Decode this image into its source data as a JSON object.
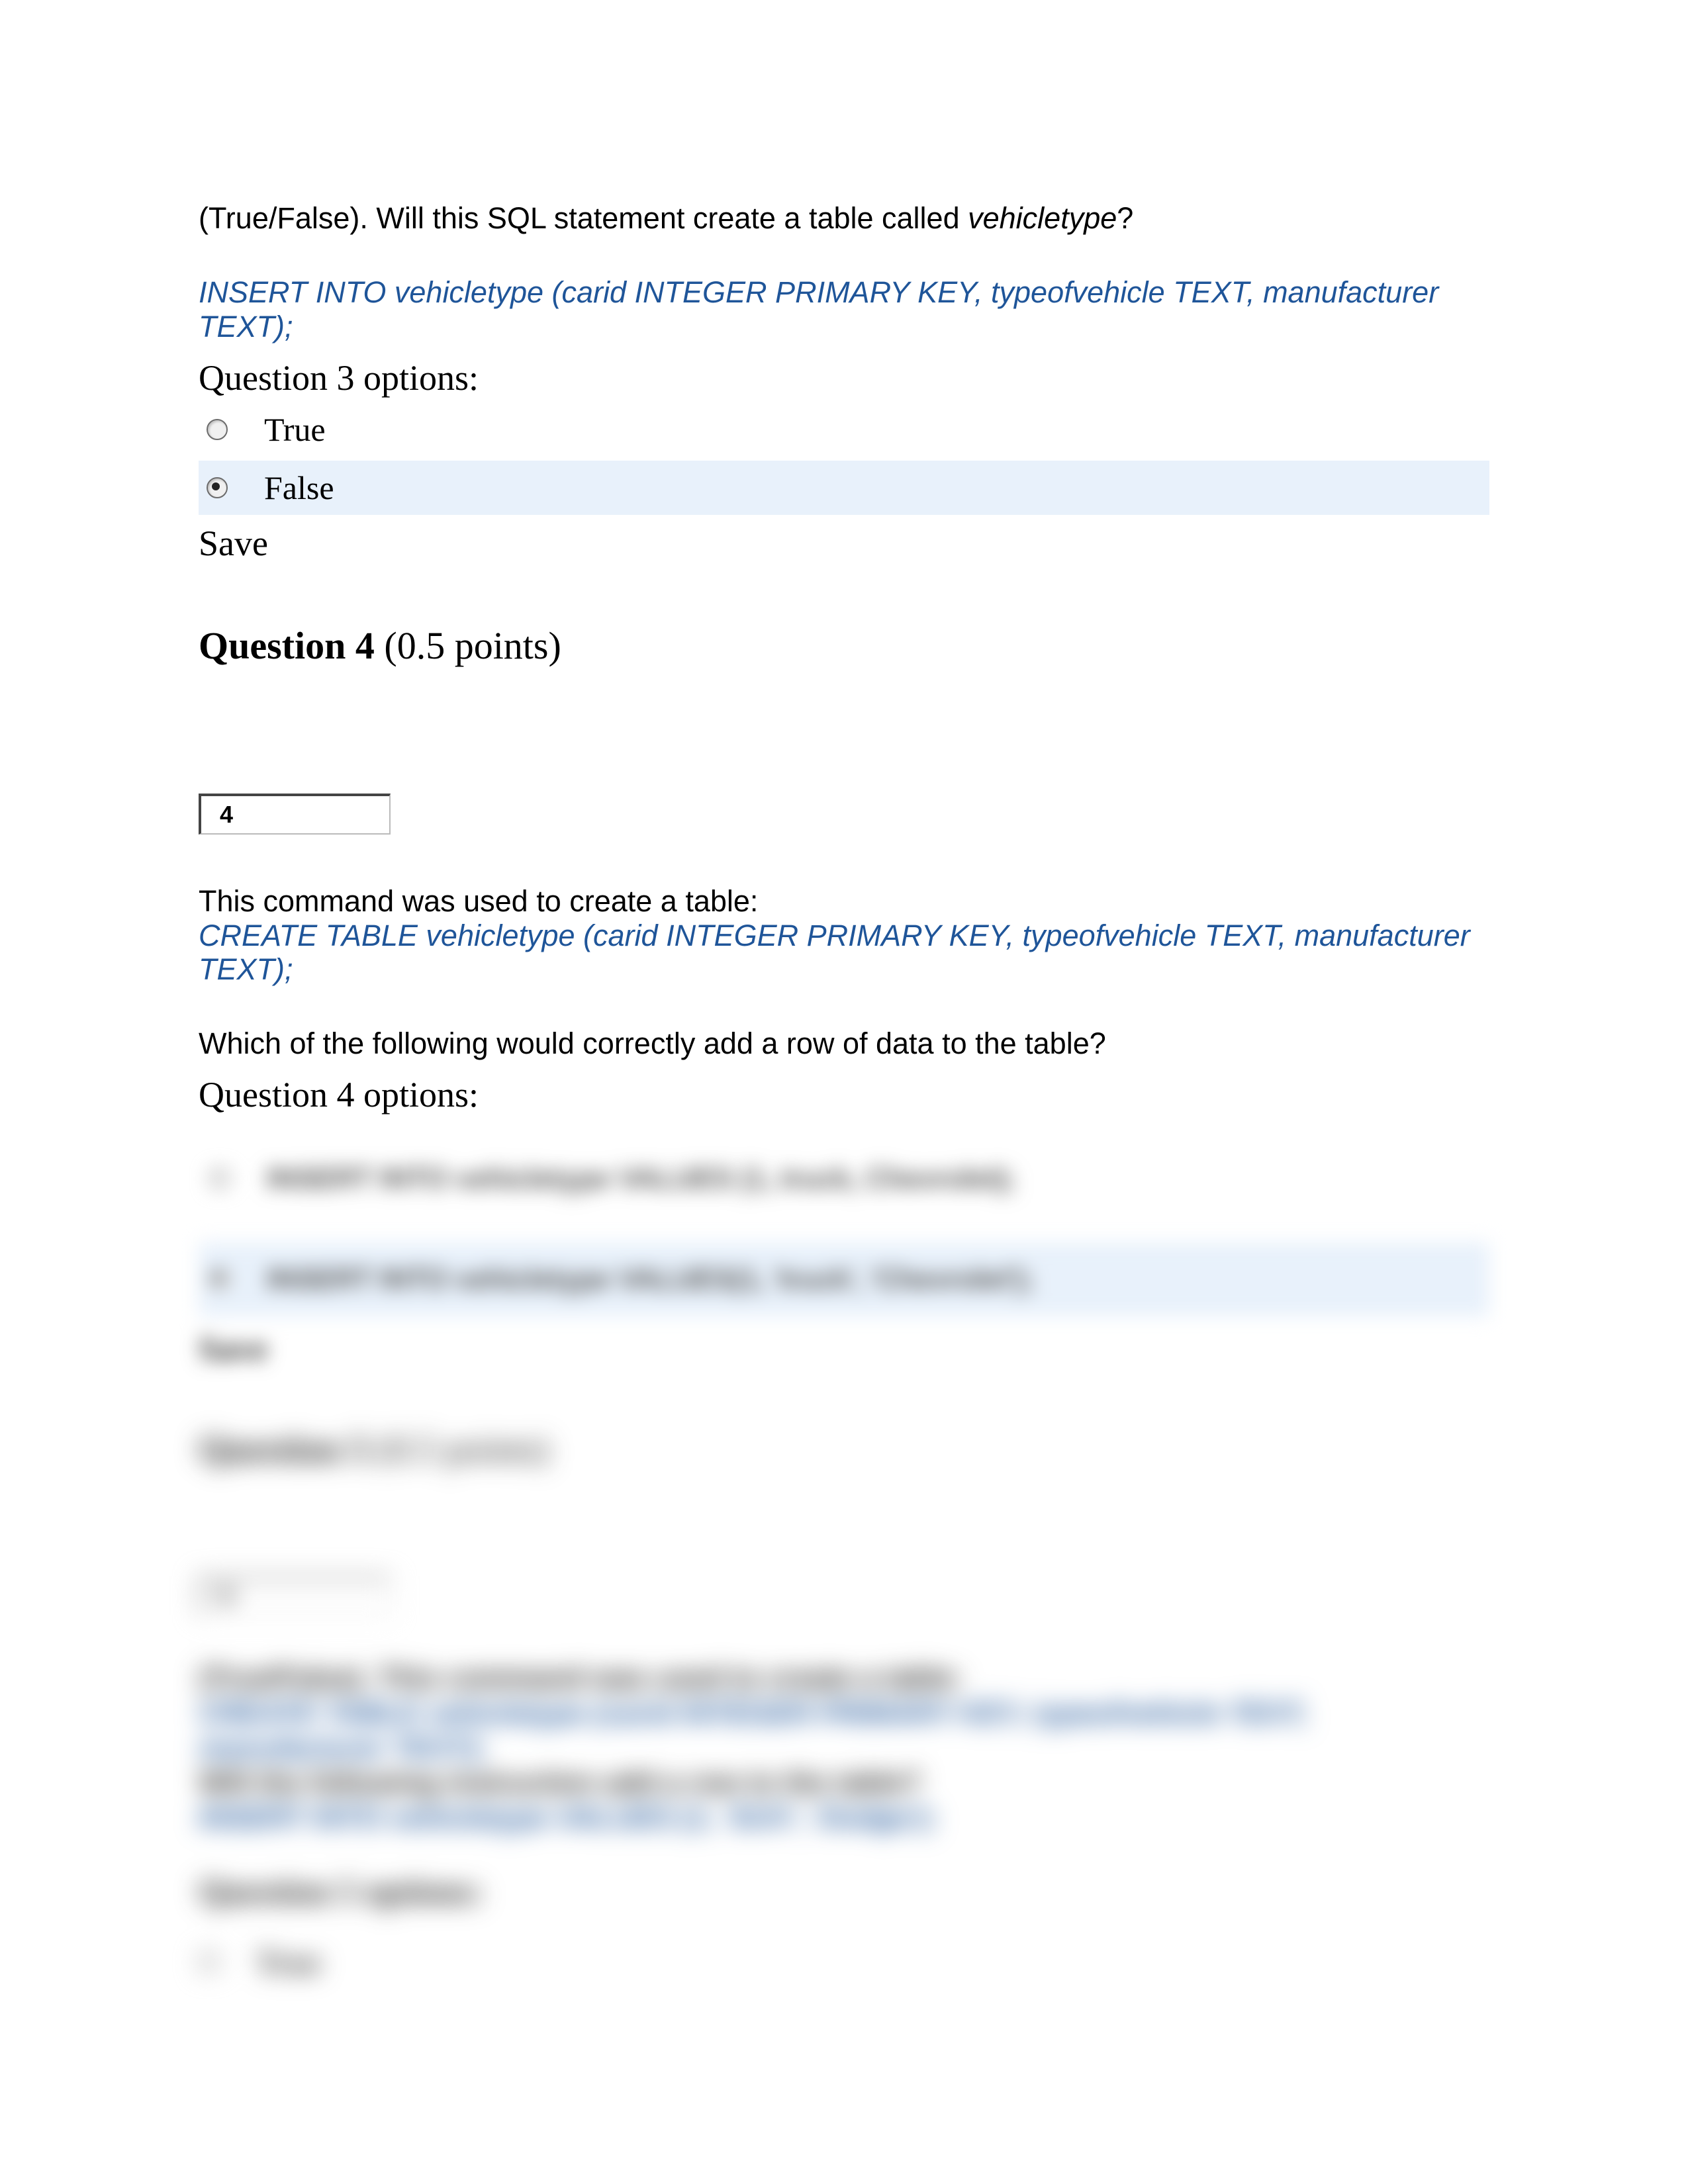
{
  "q3": {
    "prompt_prefix": "(True/False). Will this SQL statement create a table called ",
    "prompt_italic": "vehicletype",
    "prompt_suffix": "?",
    "sql": "INSERT INTO vehicletype (carid INTEGER PRIMARY KEY, typeofvehicle TEXT, manufacturer TEXT);",
    "options_heading": "Question 3 options:",
    "opt_true": "True",
    "opt_false": "False",
    "save": "Save"
  },
  "q4": {
    "header_bold": "Question 4",
    "header_rest": " (0.5 points)",
    "badge": "4",
    "line1": "This command was used to create a table:",
    "sql": "CREATE TABLE vehicletype (carid INTEGER PRIMARY KEY, typeofvehicle TEXT, manufacturer TEXT);",
    "follow": "Which of the following would correctly add a row of data to the table?",
    "options_heading": "Question 4 options:",
    "opt_a": "INSERT INTO vehicletype VALUES (1, truck, Chevrolet);",
    "opt_b": "INSERT INTO vehicletype VALUES(1, 'truck', 'Chevrolet');",
    "save": "Save"
  },
  "q5": {
    "header_bold": "Question 5",
    "header_rest": " (0.5 points)",
    "badge": "5",
    "line1": "(True/False). This command was used to create a table:",
    "sql1": "CREATE TABLE vehicletype (carid INTEGER PRIMARY KEY, typeofvehicle TEXT, manufacturer TEXT);",
    "line2": "Will the following instruction add a row to the table?",
    "sql2": "INSERT INTO vehicletype VALUES (1, 'SUV', 'Dodge');",
    "options_heading": "Question 5 options:",
    "opt_true": "True"
  }
}
